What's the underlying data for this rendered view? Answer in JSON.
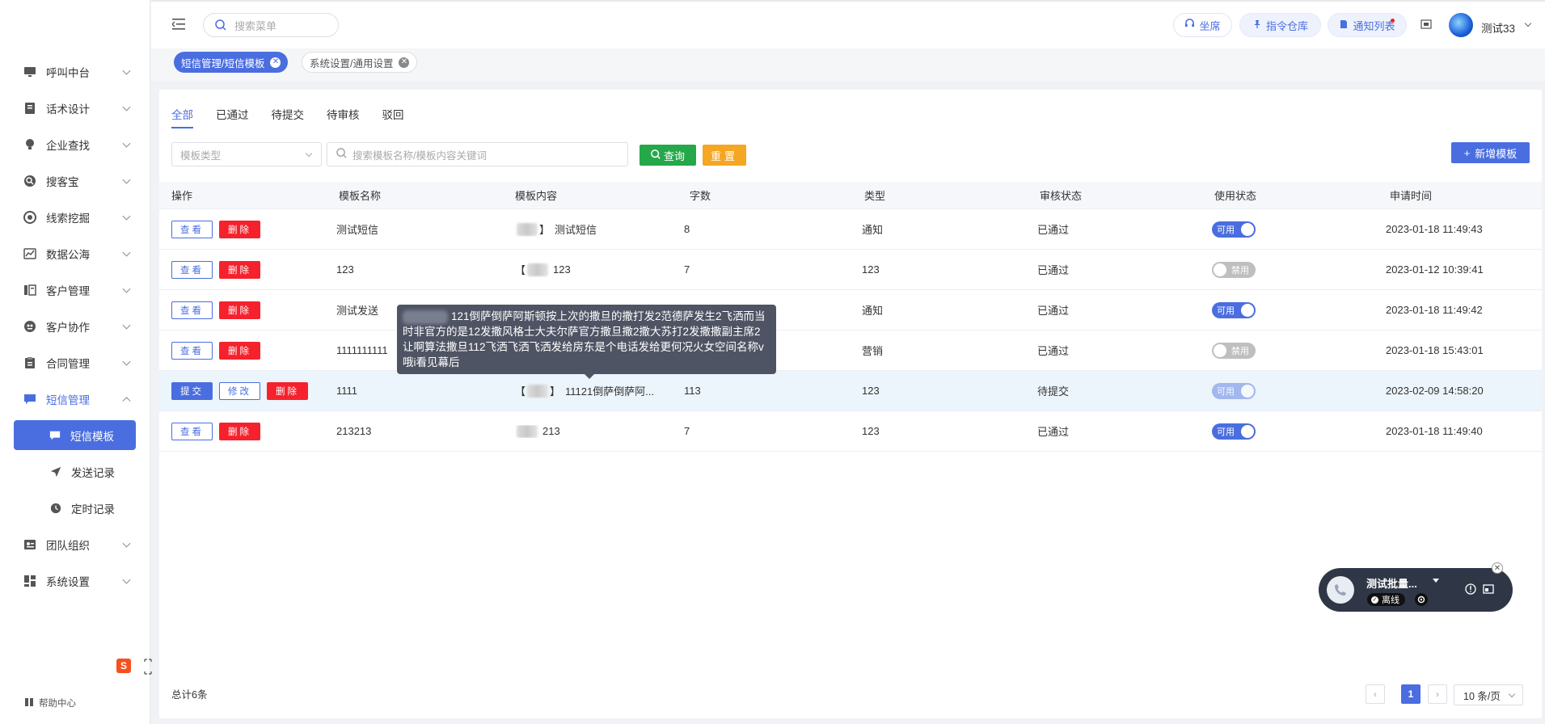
{
  "sidebar": {
    "items": [
      {
        "label": "呼叫中台",
        "icon": "monitor-icon"
      },
      {
        "label": "话术设计",
        "icon": "book-icon"
      },
      {
        "label": "企业查找",
        "icon": "lightbulb-icon"
      },
      {
        "label": "搜客宝",
        "icon": "search-circle-icon"
      },
      {
        "label": "线索挖掘",
        "icon": "target-icon"
      },
      {
        "label": "数据公海",
        "icon": "chart-icon"
      },
      {
        "label": "客户管理",
        "icon": "customer-icon"
      },
      {
        "label": "客户协作",
        "icon": "collab-icon"
      },
      {
        "label": "合同管理",
        "icon": "clipboard-icon"
      },
      {
        "label": "短信管理",
        "icon": "message-icon"
      }
    ],
    "sub_items": [
      {
        "label": "短信模板",
        "icon": "message-icon"
      },
      {
        "label": "发送记录",
        "icon": "send-icon"
      },
      {
        "label": "定时记录",
        "icon": "clock-icon"
      }
    ],
    "items_after": [
      {
        "label": "团队组织",
        "icon": "team-icon"
      },
      {
        "label": "系统设置",
        "icon": "grid-icon"
      }
    ],
    "help": "帮助中心"
  },
  "header": {
    "search_placeholder": "搜索菜单",
    "agent_label": "坐席",
    "command_label": "指令仓库",
    "notice_label": "通知列表",
    "username": "测试33"
  },
  "tags": [
    {
      "label": "短信管理/短信模板",
      "active": true
    },
    {
      "label": "系统设置/通用设置",
      "active": false
    }
  ],
  "tabs": [
    "全部",
    "已通过",
    "待提交",
    "待审核",
    "驳回"
  ],
  "filters": {
    "type_placeholder": "模板类型",
    "search_placeholder": "搜索模板名称/模板内容关键词",
    "query_label": "查询",
    "reset_label": "重置",
    "add_label": "新增模板"
  },
  "table": {
    "headers": [
      "操作",
      "模板名称",
      "模板内容",
      "字数",
      "类型",
      "审核状态",
      "使用状态",
      "申请时间"
    ],
    "rows": [
      {
        "name": "测试短信",
        "prefix": "",
        "content": "测试短信",
        "count": "8",
        "type": "通知",
        "audit": "已通过",
        "enabled": true,
        "time": "2023-01-18 11:49:43",
        "actions": [
          "查看",
          "删除"
        ]
      },
      {
        "name": "123",
        "prefix": "【",
        "content": "123",
        "count": "7",
        "type": "123",
        "audit": "已通过",
        "enabled": false,
        "time": "2023-01-12 10:39:41",
        "actions": [
          "查看",
          "删除"
        ]
      },
      {
        "name": "测试发送",
        "prefix": "",
        "content": "",
        "count": "",
        "type": "通知",
        "audit": "已通过",
        "enabled": true,
        "time": "2023-01-18 11:49:42",
        "actions": [
          "查看",
          "删除"
        ]
      },
      {
        "name": "1111111111",
        "prefix": "",
        "content": "",
        "count": "",
        "type": "营销",
        "audit": "已通过",
        "enabled": false,
        "time": "2023-01-18 15:43:01",
        "actions": [
          "查看",
          "删除"
        ]
      },
      {
        "name": "1111",
        "prefix": "【",
        "content": "11121倒萨倒萨阿...",
        "count": "113",
        "type": "123",
        "audit": "待提交",
        "enabled": true,
        "time": "2023-02-09 14:58:20",
        "actions": [
          "提交",
          "修改",
          "删除"
        ]
      },
      {
        "name": "213213",
        "prefix": "",
        "content": "213",
        "count": "7",
        "type": "123",
        "audit": "已通过",
        "enabled": true,
        "time": "2023-01-18 11:49:40",
        "actions": [
          "查看",
          "删除"
        ]
      }
    ],
    "switch_on": "可用",
    "switch_off": "禁用"
  },
  "tooltip": "121倒萨倒萨阿斯顿按上次的撒旦的撒打发2范德萨发生2飞洒而当时非官方的是12发撒风格士大夫尔萨官方撒旦撒2撒大苏打2发撒撒副主席2让啊算法撒旦112飞洒飞洒飞洒发给房东是个电话发给更何况火女空间名称v哦i看见幕后",
  "footer": {
    "total": "总计6条",
    "current_page": "1",
    "page_size": "10 条/页"
  },
  "phone_widget": {
    "name": "测试批量...",
    "status": "离线"
  },
  "colors": {
    "primary": "#4a6ee0",
    "danger": "#f5222d",
    "success": "#25a84a",
    "warning": "#f5a623"
  }
}
